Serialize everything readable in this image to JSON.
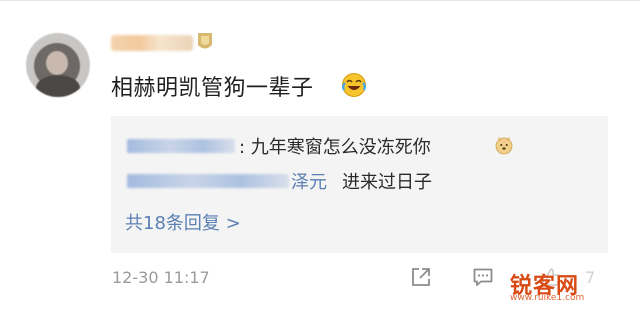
{
  "comment": {
    "text": "相赫明凯管狗一辈子",
    "emoji_icon": "laughing-crying-emoji"
  },
  "replies": [
    {
      "text": ": 九年寒窗怎么没冻死你",
      "emoji_icon": "dog-emoji"
    },
    {
      "name_tail": "泽元",
      "text": "进来过日子"
    }
  ],
  "more_replies": "共18条回复 >",
  "footer": {
    "time": "12-30 11:17",
    "like_count": "7"
  },
  "watermark": {
    "text": "锐客网",
    "sub": "www.ruike1.com"
  },
  "colors": {
    "link_blue": "#5a7fb3",
    "reply_bg": "#f4f4f4",
    "watermark": "#d94a14"
  }
}
